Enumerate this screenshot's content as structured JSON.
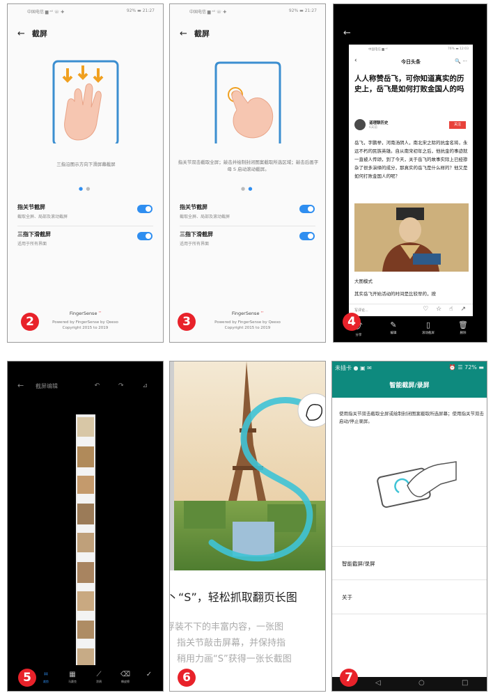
{
  "badges": [
    "2",
    "3",
    "4",
    "5",
    "6",
    "7"
  ],
  "panel2": {
    "status_left": "中国电信 ▆ ᵃˡˡ ☏ ✚",
    "status_right": "92% ▬ 21:27",
    "title": "截屏",
    "caption": "三指沿图示方向下滑屏幕截屏",
    "option1_title": "指关节截屏",
    "option1_sub": "截取全屏、局部及滚动截屏",
    "option2_title": "三指下滑截屏",
    "option2_sub": "适用于所有界面",
    "brand": "FingerSense",
    "footer1": "Powered by FingerSense by Qeexo",
    "footer2": "Copyright 2015 to 2019"
  },
  "panel3": {
    "status_left": "中国电信 ▆ ᵃˡˡ ☏ ✚",
    "status_right": "92% ▬ 21:27",
    "title": "截屏",
    "caption": "指关节双击截取全屏；敲击并绘制封闭图案截取所选区域；敲击后画字母 S 启动滚动截屏。",
    "option1_title": "指关节截屏",
    "option1_sub": "截取全屏、局部及滚动截屏",
    "option2_title": "三指下滑截屏",
    "option2_sub": "适用于所有界面",
    "brand": "FingerSense",
    "footer1": "Powered by FingerSense by Qeexo",
    "footer2": "Copyright 2015 to 2019"
  },
  "panel4": {
    "status_left": "中国电信 ▆ ᵃˡˡ",
    "status_right": "76% ▬ 12:03",
    "app_title": "今日头条",
    "article_title": "人人称赞岳飞，可你知道真实的历史上，岳飞是如何打败金国人的吗",
    "author": "道理聊历史",
    "author_date": "6天前",
    "follow": "关注",
    "body": "岳飞，字鹏举，河南汤阴人，南北宋之际的抗金名将，永远不朽的民族英雄。自从南宋初年之后，他抗金的事迹就一直被人传颂，到了今天，关于岳飞的故事实际上已经掺杂了很多演绎的成分，那真实的岳飞是什么样的？他又是如何打败金国人的呢？",
    "subheading": "大图模式",
    "body2": "其实岳飞开始活动的时间是比较早的，按",
    "comment_placeholder": "写评论...",
    "bottom_icons": "♡ ☆ ☝ ↗",
    "toolbar": [
      {
        "icon": "share",
        "glyph": "⤴",
        "label": "分享"
      },
      {
        "icon": "edit",
        "glyph": "✎",
        "label": "编辑"
      },
      {
        "icon": "scroll",
        "glyph": "▯",
        "label": "滚动截屏"
      },
      {
        "icon": "delete",
        "glyph": "🗑",
        "label": "删除"
      }
    ]
  },
  "panel5": {
    "title": "截屏编辑",
    "top_icons": "↶ ↷ ⊿",
    "toolbar": [
      {
        "icon": "crop",
        "glyph": "⌗",
        "label": "裁剪"
      },
      {
        "icon": "mosaic",
        "glyph": "▦",
        "label": "马赛克"
      },
      {
        "icon": "brush",
        "glyph": "⟋",
        "label": "涂鸦"
      },
      {
        "icon": "eraser",
        "glyph": "⌫",
        "label": "橡皮擦"
      },
      {
        "icon": "check",
        "glyph": "✓",
        "label": ""
      }
    ]
  },
  "panel6": {
    "headline": "丶“S”，轻松抓取翻页长图",
    "line1": "浮装不下的丰富内容，一张图",
    "line2": "指关节敲击屏幕，并保持指",
    "line3": "稍用力画“S”获得一张长截图"
  },
  "panel7": {
    "status_left": "未插卡 ● ▣ ✉",
    "status_right": "⏰ ☰ 72% ▬",
    "title": "智能截屏/录屏",
    "desc": "使用指关节双击截取全屏或绘制封闭图案截取所选屏幕；使用指关节双击启动/停止录屏。",
    "item1": "智能截屏/录屏",
    "item2": "关于",
    "nav": [
      "◁",
      "○",
      "□"
    ]
  },
  "colors": {
    "accent": "#2f8ef0",
    "badge": "#e8222a",
    "teal": "#0e8a7e"
  }
}
